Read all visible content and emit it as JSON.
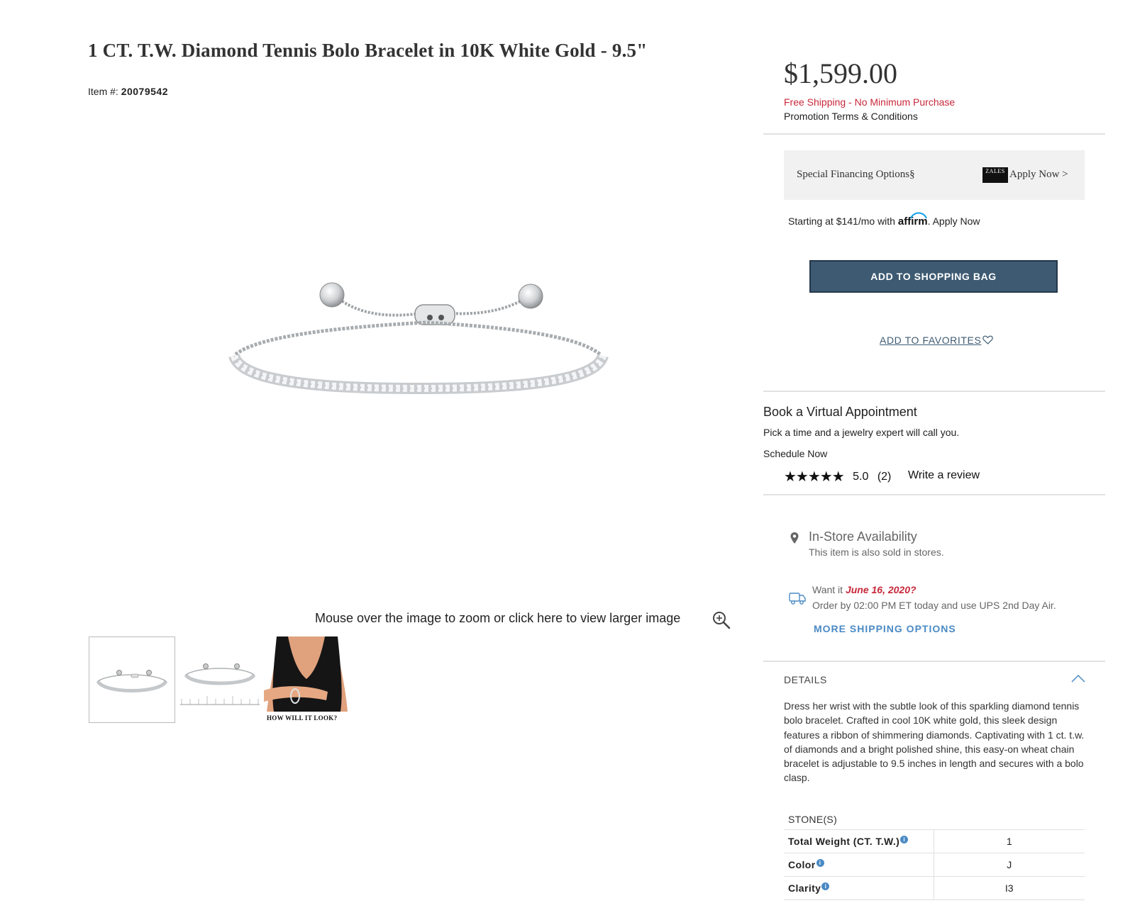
{
  "product": {
    "title": "1 CT. T.W. Diamond Tennis Bolo Bracelet in 10K White Gold - 9.5\"",
    "item_label": "Item #:",
    "item_number": "20079542"
  },
  "gallery": {
    "zoom_hint": "Mouse over the image to zoom or click here to view larger image",
    "thumbnail_3_caption": "HOW WILL IT LOOK?"
  },
  "pricing": {
    "price": "$1,599.00",
    "free_shipping": "Free Shipping - No Minimum Purchase",
    "promo_terms": "Promotion Terms & Conditions"
  },
  "financing": {
    "label": "Special Financing Options§",
    "logo_text": "ZALES",
    "apply_link": "Apply Now >",
    "affirm_prefix": "Starting at $141/mo with ",
    "affirm_brand": "affirm",
    "affirm_suffix": ". Apply Now"
  },
  "actions": {
    "add_to_bag": "ADD TO SHOPPING BAG",
    "add_to_favorites": "ADD TO FAVORITES"
  },
  "appointment": {
    "heading": "Book a Virtual Appointment",
    "subtext": "Pick a time and a jewelry expert will call you.",
    "link": "Schedule Now"
  },
  "reviews": {
    "stars": "★★★★★",
    "rating": 5.0,
    "rating_text": "5.0",
    "count_text": "(2)",
    "write_review": "Write a review"
  },
  "availability": {
    "heading": "In-Store Availability",
    "subtext": "This item is also sold in stores."
  },
  "shipping": {
    "want_prefix": "Want it ",
    "want_date": "June 16, 2020?",
    "order_by": "Order by 02:00 PM ET today and use UPS 2nd Day Air.",
    "more_options": "MORE SHIPPING OPTIONS"
  },
  "details": {
    "heading": "DETAILS",
    "description": "Dress her wrist with the subtle look of this sparkling diamond tennis bolo bracelet. Crafted in cool 10K white gold, this sleek design features a ribbon of shimmering diamonds. Captivating with 1 ct. t.w. of diamonds and a bright polished shine, this easy-on wheat chain bracelet is adjustable to 9.5 inches in length and secures with a bolo clasp.",
    "stones_heading": "STONE(S)",
    "stones": [
      {
        "key": "Total Weight (CT. T.W.)",
        "value": "1"
      },
      {
        "key": "Color",
        "value": "J"
      },
      {
        "key": "Clarity",
        "value": "I3"
      }
    ]
  },
  "colors": {
    "accent_red": "#c8283a",
    "button_blue": "#3d5a72",
    "link_blue": "#4a8ac4",
    "financing_bg": "#f1f1f1"
  },
  "icons": [
    "zoom-in-icon",
    "heart-icon",
    "star-icon",
    "map-pin-icon",
    "truck-icon",
    "chevron-up-icon",
    "info-icon"
  ]
}
